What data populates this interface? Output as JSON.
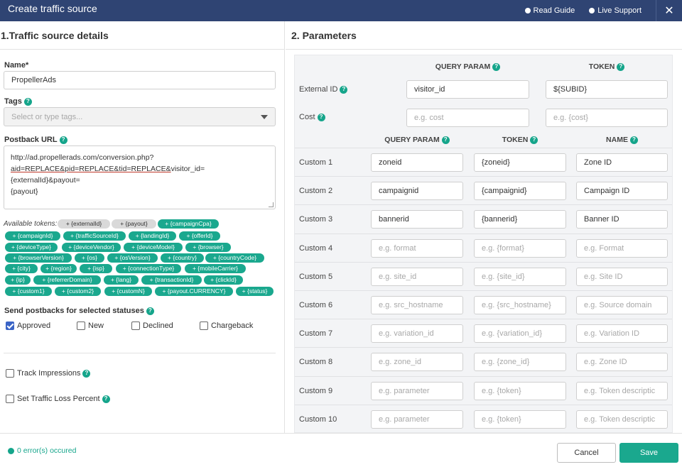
{
  "window": {
    "title": "Create traffic source",
    "read_guide": "Read Guide",
    "live_support": "Live Support",
    "close": "✕"
  },
  "left": {
    "title": "1.Traffic source details",
    "name_label": "Name*",
    "name_value": "PropellerAds",
    "tags_label": "Tags",
    "tags_placeholder": "Select or type tags...",
    "postback_label": "Postback URL",
    "postback_line1": "http://ad.propellerads.com/conversion.php?",
    "postback_line2a": "aid=REPLACE&pid=REPLACE&tid=REPLACE&",
    "postback_line2b": "visitor_id={externalId}&payout=",
    "postback_line3": "{payout}",
    "tokens_label": "Available tokens:",
    "tokens": [
      {
        "label": "+ {externalId}",
        "style": "gray"
      },
      {
        "label": "+ {payout}",
        "style": "gray"
      },
      {
        "label": "+ {campaignCpa}",
        "style": "teal"
      },
      {
        "label": "+ {campaignId}",
        "style": "teal"
      },
      {
        "label": "+ {trafficSourceId}",
        "style": "teal"
      },
      {
        "label": "+ {landingId}",
        "style": "teal"
      },
      {
        "label": "+ {offerId}",
        "style": "teal"
      },
      {
        "label": "+ {deviceType}",
        "style": "teal"
      },
      {
        "label": "+ {deviceVendor}",
        "style": "teal"
      },
      {
        "label": "+ {deviceModel}",
        "style": "teal"
      },
      {
        "label": "+ {browser}",
        "style": "teal"
      },
      {
        "label": "+ {browserVersion}",
        "style": "teal"
      },
      {
        "label": "+ {os}",
        "style": "teal"
      },
      {
        "label": "+ {osVersion}",
        "style": "teal"
      },
      {
        "label": "+ {country}",
        "style": "teal"
      },
      {
        "label": "+ {countryCode}",
        "style": "teal"
      },
      {
        "label": "+ {city}",
        "style": "teal"
      },
      {
        "label": "+ {region}",
        "style": "teal"
      },
      {
        "label": "+ {isp}",
        "style": "teal"
      },
      {
        "label": "+ {connectionType}",
        "style": "teal"
      },
      {
        "label": "+ {mobileCarrier}",
        "style": "teal"
      },
      {
        "label": "+ {ip}",
        "style": "teal"
      },
      {
        "label": "+ {referrerDomain}",
        "style": "teal"
      },
      {
        "label": "+ {lang}",
        "style": "teal"
      },
      {
        "label": "+ {transactionId}",
        "style": "teal"
      },
      {
        "label": "+ {clickId}",
        "style": "teal"
      },
      {
        "label": "+ {custom1}",
        "style": "teal"
      },
      {
        "label": "+ {custom2}",
        "style": "teal"
      },
      {
        "label": "+ {customN}",
        "style": "teal"
      },
      {
        "label": "+ {payout.CURRENCY}",
        "style": "teal"
      },
      {
        "label": "+ {status}",
        "style": "teal"
      }
    ],
    "statuses_label": "Send postbacks for selected statuses",
    "statuses": [
      {
        "label": "Approved",
        "checked": true
      },
      {
        "label": "New",
        "checked": false
      },
      {
        "label": "Declined",
        "checked": false
      },
      {
        "label": "Chargeback",
        "checked": false
      }
    ],
    "track_impressions": "Track Impressions",
    "traffic_loss": "Set Traffic Loss Percent"
  },
  "right": {
    "title": "2. Parameters",
    "query_param_header": "QUERY PARAM",
    "token_header": "TOKEN",
    "name_header": "NAME",
    "external_id": {
      "label": "External ID",
      "param": "visitor_id",
      "token": "${SUBID}"
    },
    "cost": {
      "label": "Cost",
      "param_placeholder": "e.g. cost",
      "token_placeholder": "e.g. {cost}"
    },
    "customs": [
      {
        "label": "Custom 1",
        "param": "zoneid",
        "token": "{zoneid}",
        "name": "Zone ID",
        "filled": true
      },
      {
        "label": "Custom 2",
        "param": "campaignid",
        "token": "{campaignid}",
        "name": "Campaign ID",
        "filled": true
      },
      {
        "label": "Custom 3",
        "param": "bannerid",
        "token": "{bannerid}",
        "name": "Banner ID",
        "filled": true
      },
      {
        "label": "Custom 4",
        "param": "e.g. format",
        "token": "e.g. {format}",
        "name": "e.g. Format",
        "filled": false
      },
      {
        "label": "Custom 5",
        "param": "e.g. site_id",
        "token": "e.g. {site_id}",
        "name": "e.g. Site ID",
        "filled": false
      },
      {
        "label": "Custom 6",
        "param": "e.g. src_hostname",
        "token": "e.g. {src_hostname}",
        "name": "e.g. Source domain",
        "filled": false
      },
      {
        "label": "Custom 7",
        "param": "e.g. variation_id",
        "token": "e.g. {variation_id}",
        "name": "e.g. Variation ID",
        "filled": false
      },
      {
        "label": "Custom 8",
        "param": "e.g. zone_id",
        "token": "e.g. {zone_id}",
        "name": "e.g. Zone ID",
        "filled": false
      },
      {
        "label": "Custom 9",
        "param": "e.g. parameter",
        "token": "e.g. {token}",
        "name": "e.g. Token descriptic",
        "filled": false
      },
      {
        "label": "Custom 10",
        "param": "e.g. parameter",
        "token": "e.g. {token}",
        "name": "e.g. Token descriptic",
        "filled": false
      }
    ]
  },
  "footer": {
    "status": "0 error(s) occured",
    "cancel": "Cancel",
    "save": "Save"
  },
  "colors": {
    "header_bg": "#2f4473",
    "accent": "#1aa88e",
    "checkbox": "#3a64c6"
  }
}
